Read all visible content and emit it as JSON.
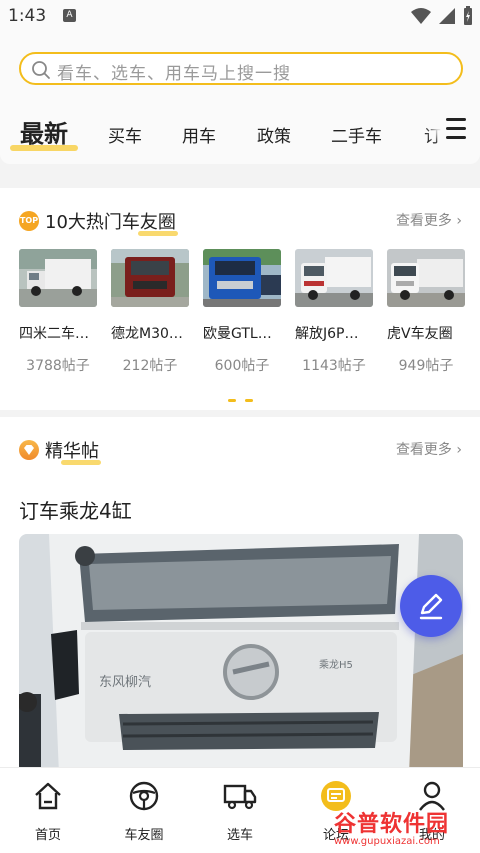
{
  "status_bar": {
    "time": "1:43",
    "badge": "A"
  },
  "search": {
    "placeholder": "看车、选车、用车马上搜一搜"
  },
  "tabs": [
    {
      "label": "最新",
      "active": true
    },
    {
      "label": "买车"
    },
    {
      "label": "用车"
    },
    {
      "label": "政策"
    },
    {
      "label": "二手车"
    },
    {
      "label": "订"
    }
  ],
  "hot_circles": {
    "badge": "TOP",
    "title": "10大热门车友圈",
    "more": "查看更多",
    "items": [
      {
        "name": "四米二车…",
        "posts": "3788帖子"
      },
      {
        "name": "德龙M30…",
        "posts": "212帖子"
      },
      {
        "name": "欧曼GTL…",
        "posts": "600帖子"
      },
      {
        "name": "解放J6P…",
        "posts": "1143帖子"
      },
      {
        "name": "虎V车友圈",
        "posts": "949帖子"
      }
    ]
  },
  "featured": {
    "title": "精华帖",
    "more": "查看更多",
    "post_title": "订车乘龙4缸",
    "image_text": {
      "brand": "东风柳汽",
      "model": "乘龙H5"
    }
  },
  "bottom_nav": [
    {
      "label": "首页",
      "icon": "home-icon"
    },
    {
      "label": "车友圈",
      "icon": "steering-wheel-icon"
    },
    {
      "label": "选车",
      "icon": "truck-icon"
    },
    {
      "label": "论坛",
      "icon": "forum-icon"
    },
    {
      "label": "我的",
      "icon": "user-icon"
    }
  ],
  "watermark": {
    "main": "谷普软件园",
    "sub": "www.gupuxiazai.com"
  },
  "colors": {
    "accent": "#f3bd1c",
    "fab": "#4d5ce8",
    "watermark": "#e33333"
  }
}
